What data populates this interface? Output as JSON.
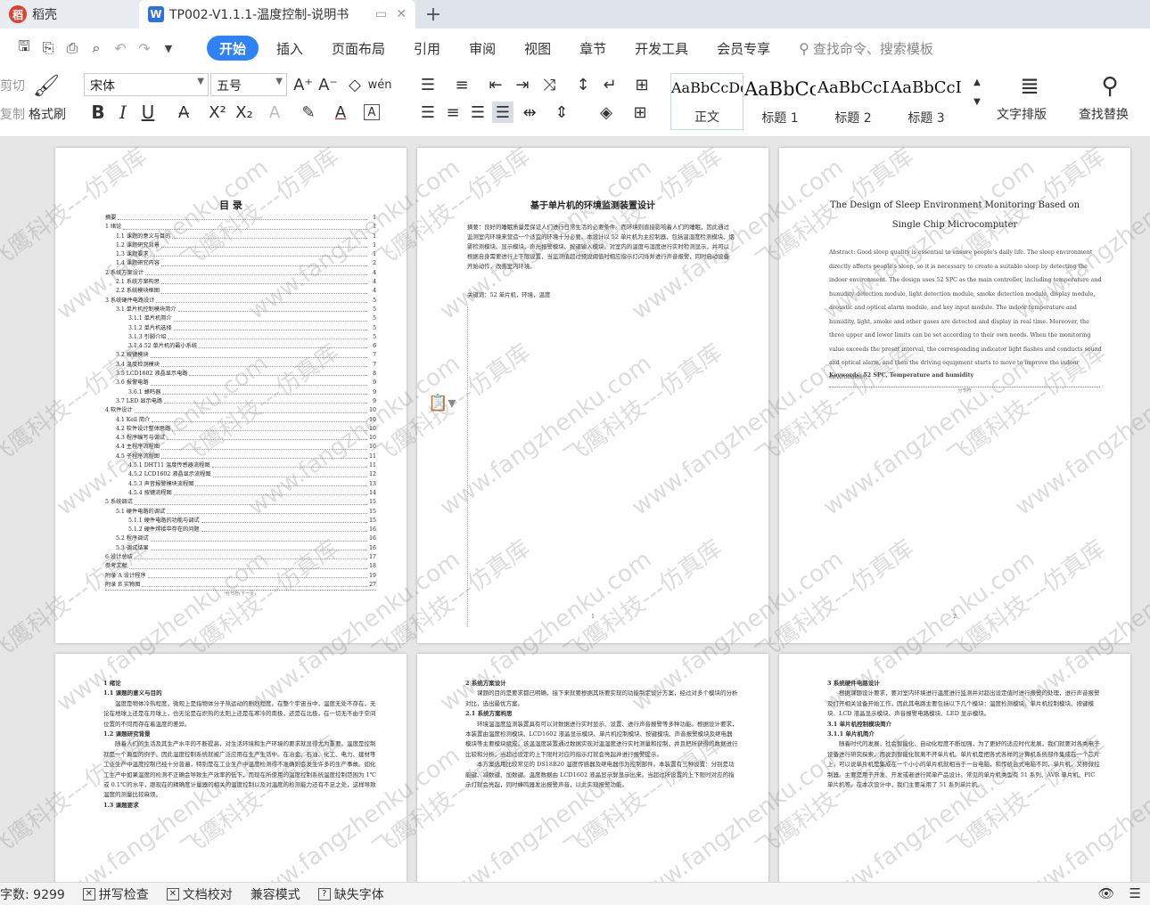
{
  "tabs": {
    "home_label": "稻壳",
    "doc_label": "TP002-V1.1.1-温度控制-说明书"
  },
  "menu": {
    "items": [
      "开始",
      "插入",
      "页面布局",
      "引用",
      "审阅",
      "视图",
      "章节",
      "开发工具",
      "会员专享"
    ],
    "search_placeholder": "查找命令、搜索模板"
  },
  "ribbon": {
    "cut": "剪切",
    "copy": "复制",
    "format_painter": "格式刷",
    "font_name": "宋体",
    "font_size": "五号",
    "styles": [
      {
        "sample": "AaBbCcDd",
        "name": "正文"
      },
      {
        "sample": "AaBbCc",
        "name": "标题 1"
      },
      {
        "sample": "AaBbCcD",
        "name": "标题 2"
      },
      {
        "sample": "AaBbCcI",
        "name": "标题 3"
      }
    ],
    "text_layout": "文字排版",
    "find_replace": "查找替换"
  },
  "page1": {
    "title": "目  录",
    "toc": [
      {
        "t": "摘要",
        "n": "1",
        "lv": 1
      },
      {
        "t": "1  绪论",
        "n": "1",
        "lv": 1
      },
      {
        "t": "1.1 课题的意义与目的",
        "n": "1",
        "lv": 2
      },
      {
        "t": "1.2 课题研究背景",
        "n": "1",
        "lv": 2
      },
      {
        "t": "1.3 课题要求",
        "n": "1",
        "lv": 2
      },
      {
        "t": "1.4 课题研究内容",
        "n": "2",
        "lv": 2
      },
      {
        "t": "2  系统方案设计",
        "n": "4",
        "lv": 1
      },
      {
        "t": "2.1 系统方案构思",
        "n": "4",
        "lv": 2
      },
      {
        "t": "2.2 系统模块框图",
        "n": "4",
        "lv": 2
      },
      {
        "t": "3  系统硬件电路设计",
        "n": "5",
        "lv": 1
      },
      {
        "t": "3.1 单片机控制模块简介",
        "n": "5",
        "lv": 2
      },
      {
        "t": "3.1.1 单片机简介",
        "n": "5",
        "lv": 3
      },
      {
        "t": "3.1.2 单片机选择",
        "n": "5",
        "lv": 3
      },
      {
        "t": "3.1.3 引脚介绍",
        "n": "5",
        "lv": 3
      },
      {
        "t": "3.1.4 52 单片机的最小系统",
        "n": "6",
        "lv": 3
      },
      {
        "t": "3.2 按键模块",
        "n": "7",
        "lv": 2
      },
      {
        "t": "3.4 温度检测模块",
        "n": "7",
        "lv": 2
      },
      {
        "t": "3.5 LCD1602 液晶显示电路",
        "n": "8",
        "lv": 2
      },
      {
        "t": "3.6 报警电路",
        "n": "9",
        "lv": 2
      },
      {
        "t": "3.6.1 蜂鸣器",
        "n": "9",
        "lv": 3
      },
      {
        "t": "3.7 LED 显示电路",
        "n": "9",
        "lv": 2
      },
      {
        "t": "4  软件设计",
        "n": "10",
        "lv": 1
      },
      {
        "t": "4.1 Keil 简介",
        "n": "10",
        "lv": 2
      },
      {
        "t": "4.2 软件设计整体思路",
        "n": "10",
        "lv": 2
      },
      {
        "t": "4.3 程序编写与调试",
        "n": "10",
        "lv": 2
      },
      {
        "t": "4.4 主程序流程图",
        "n": "10",
        "lv": 2
      },
      {
        "t": "4.5 子程序流程图",
        "n": "11",
        "lv": 2
      },
      {
        "t": "4.5.1 DHT11 温度传感器流程图",
        "n": "11",
        "lv": 3
      },
      {
        "t": "4.5.2 LCD1602 液晶显示流程图",
        "n": "12",
        "lv": 3
      },
      {
        "t": "4.5.3 声音报警模块流程图",
        "n": "13",
        "lv": 3
      },
      {
        "t": "4.5.4 按键流程图",
        "n": "14",
        "lv": 3
      },
      {
        "t": "5  系统调试",
        "n": "15",
        "lv": 1
      },
      {
        "t": "5.1 硬件电路的调试",
        "n": "15",
        "lv": 2
      },
      {
        "t": "5.1.1 硬件电路的功能与调试",
        "n": "15",
        "lv": 3
      },
      {
        "t": "5.1.2 硬件焊接中存在的问题",
        "n": "16",
        "lv": 3
      },
      {
        "t": "5.2 程序调试",
        "n": "16",
        "lv": 2
      },
      {
        "t": "5.3 调试结果",
        "n": "16",
        "lv": 2
      },
      {
        "t": "6  设计总结",
        "n": "17",
        "lv": 1
      },
      {
        "t": "参考文献",
        "n": "18",
        "lv": 1
      },
      {
        "t": "附录 A 设计程序",
        "n": "19",
        "lv": 1
      },
      {
        "t": "附录 B 实物图",
        "n": "27",
        "lv": 1
      }
    ],
    "section_break": "分节符(下一页)"
  },
  "page2": {
    "title": "基于单片机的环境监测装置设计",
    "abstract": "摘要：良好的睡眠质量是保证人们进行日常生活的必要条件。而环境则直接影响着人们的睡眠，因此通过监测室内环境来营造一个适宜的环境十分必要。本设计以 52 单片机为主控制器，包括温湿度检测模块、烟雾检测模块、显示模块、声光报警模块、按键输入模块，对室内的温度与湿度进行实时检测显示，并可以根据自身需要进行上下限设置，当监测值超过预设阈值时相应指示灯闪烁并进行声音报警，同时启动设备开始动作，改善室内环境。",
    "keywords": "关键词：52 单片机，环境，温度",
    "page_number": "1"
  },
  "page3": {
    "title_line1": "The Design of Sleep Environment Monitoring Based on",
    "title_line2": "Single Chip Microcomputer",
    "abstract": "Abstract: Good sleep quality is essential to ensure people's daily life. The sleep environment directly affects people's sleep, so it is necessary to create a suitable sleep by detecting the indoor environment. The design uses 52 SPC as the main controller, including temperature and humidity detection module, light detection module, smoke detection module, display module, acoustic and optical alarm module, and key input module. The indoor temperature and humidity, light, smoke and other gases are detected and display in real time. Moreover, the three upper and lower limits can be set according to their own needs. When the monitoring value exceeds the preset interval, the corresponding indicator light flashes and conducts sound and optical alarm, and then the driving equipment starts to move to improve the indoor environment.",
    "keywords": "Keywords: 52 SPC, Temperature and humidity",
    "section_break": "分节符",
    "page_number": "2"
  },
  "page4": {
    "h1": "1  绪论",
    "h2a": "1.1 课题的意义与目的",
    "p1": "温度是物体冷热程度，微观上是指物体分子热运动的剧烈程度。在整个宇宙当中，温度无处不存在，无论在地球上还是在月球上，也无论是在炽热的太阳上还是在寒冷的南极，还是在北极，在一切无不由于空间位置的不同而存在着温度的差异。",
    "h2b": "1.2 课题研究背景",
    "p2": "随着人们的生活及其生产水平的不断提高，对生活环境和生产环境的要求就显得尤为重要。温度是控制就是一个典型的例子。因此温度控制系统就被广泛应用在生产生活中。在冶金、石油、化工、电力、建材等工业生产中温度控制已经十分普遍，特别是在工业生产中温度检测得不准确则会发生许多的生产事故。如化工生产中如果温度的检测不正确会导致生产效率的低下，而现在所使用的温度控制系统温度控制范围为 1℃或 0.1℃的水平，跟现在的精确度计量器的相关的温度控制以及对温度的检测能力还有不足之处，这样导致温度的测量比较麻烦。",
    "h2c": "1.3 课题要求"
  },
  "page5": {
    "h1": "2  系统方案设计",
    "p1": "课题的目的是要求都已明确，接下来就要根据其所要实现的功能制定设计方案，经过对多个模块的分析对比，选出最优方案。",
    "h2": "2.1 系统方案构思",
    "p2": "环境温湿度监测装置具有可以对数据进行实时显示、设置、进行声音报警等多种功能。根据设计要求，本装置由温度检测模块、LCD1602 液晶显示模块、单片机控制模块、按键模块、声音报警模块及继电器模块等主要模块组成。该温湿度装置通过数据实现对温湿度进行实时测量和控制，并且把所获得的数据进行比较和分析，当超过设定的上下限时对应的指示灯就会亮起并进行报警提示。",
    "p3": "本方案选用比较常见的 DS18B20 温度传感器及继电器作为控制部件。本装置有三种设置：分别是功能键、减数键、加数键。温度数据由 LCD1602 液晶显示屏显示出来。当超过所设置的上下限时对应的指示灯就会亮起，同时蜂鸣器发出报警声音，以此实现报警功能。"
  },
  "page6": {
    "h1": "3  系统硬件电路设计",
    "p1": "根据课题设计要求，要对室内环境进行温度进行监测并对超出设定值时进行报警的处理，进行声音报警及打开相关设备开始工作，因此其电路主要包括以下几个模块：温度检测模块、单片机控制模块、按键模块、LCD 液晶显示模块、声音报警电路模块、LED 显示模块。",
    "h2": "3.1 单片机控制模块简介",
    "h3": "3.1.1 单片机简介",
    "p2": "随着时代的发展，社会智能化、自动化程度不断加强，为了更好的适应时代发展，我们就要对各类电子设备进行研究探索，而说到智能化就离不开单片机。单片机是把各式各样的计算机系统部件集成在一个芯片上，可以说单片机是集成在一个小小的单片机就相当于一台电脑，和传统台式电脑不同，单片机，又称微控制器。主要是用于开发、开发或者进行简单产品设计。常见的单片机类型有 51 系列、AVR 单片机、PIC 单片机等。在本次设计中，我们主要采用了 51 系列单片机。"
  },
  "status": {
    "word_count": "字数: 9299",
    "spell_check": "拼写检查",
    "doc_proof": "文档校对",
    "compat_mode": "兼容模式",
    "missing_font": "缺失字体"
  },
  "watermark": {
    "text": "飞鹰科技---仿真库",
    "url": "www.fangzhenku.com"
  }
}
